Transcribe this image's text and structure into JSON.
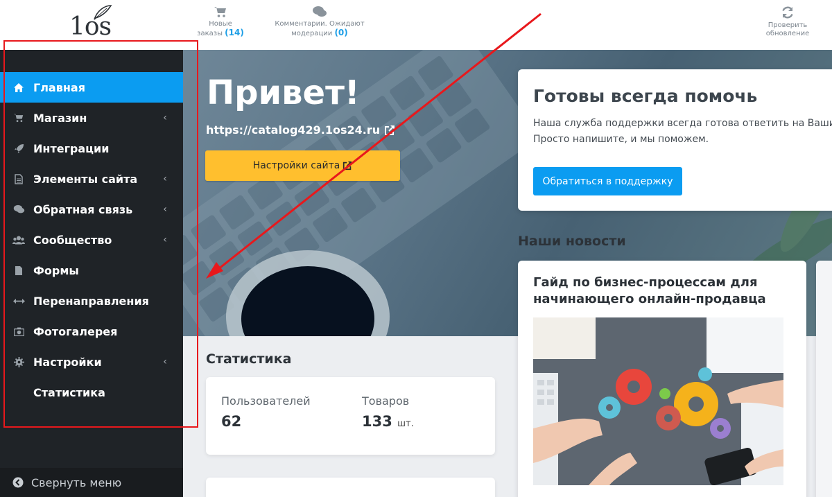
{
  "logo": {
    "text": "1os"
  },
  "topbar": {
    "orders": {
      "label": "Новые заказы",
      "count": "(14)"
    },
    "comments": {
      "label": "Комментарии. Ожидают модерации",
      "count": "(0)"
    },
    "update": {
      "label": "Проверить обновление"
    }
  },
  "sidebar": {
    "items": [
      {
        "label": "Главная",
        "icon": "home-icon",
        "active": true,
        "has_submenu": false
      },
      {
        "label": "Магазин",
        "icon": "cart-icon",
        "has_submenu": true
      },
      {
        "label": "Интеграции",
        "icon": "rocket-icon",
        "has_submenu": false
      },
      {
        "label": "Элементы сайта",
        "icon": "file-icon",
        "has_submenu": true
      },
      {
        "label": "Обратная связь",
        "icon": "comments-icon",
        "has_submenu": true
      },
      {
        "label": "Сообщество",
        "icon": "users-icon",
        "has_submenu": true
      },
      {
        "label": "Формы",
        "icon": "document-icon",
        "has_submenu": false
      },
      {
        "label": "Перенаправления",
        "icon": "arrows-icon",
        "has_submenu": false
      },
      {
        "label": "Фотогалерея",
        "icon": "camera-icon",
        "has_submenu": false
      },
      {
        "label": "Настройки",
        "icon": "gear-icon",
        "has_submenu": true
      },
      {
        "label": "Статистика",
        "icon": "",
        "has_submenu": false
      }
    ],
    "collapse_label": "Свернуть меню",
    "chevron": "‹"
  },
  "hero": {
    "title": "Привет!",
    "url": "https://catalog429.1os24.ru",
    "settings_button": "Настройки сайта"
  },
  "help": {
    "title": "Готовы всегда помочь",
    "line1": "Наша служба поддержки всегда готова ответить на Ваши",
    "line2": "Просто напишите, и мы поможем.",
    "button": "Обратиться в поддержку"
  },
  "news": {
    "heading": "Наши новости",
    "card_title": "Гайд по бизнес-процессам для начинающего онлайн-продавца"
  },
  "stats": {
    "heading": "Статистика",
    "users_label": "Пользователей",
    "users_value": "62",
    "goods_label": "Товаров",
    "goods_value": "133",
    "goods_unit": "шт."
  },
  "colors": {
    "accent": "#0b9cf1",
    "sidebar_bg": "#1f2327",
    "button_yellow": "#ffbf2e",
    "annotation_red": "#e8181c"
  }
}
